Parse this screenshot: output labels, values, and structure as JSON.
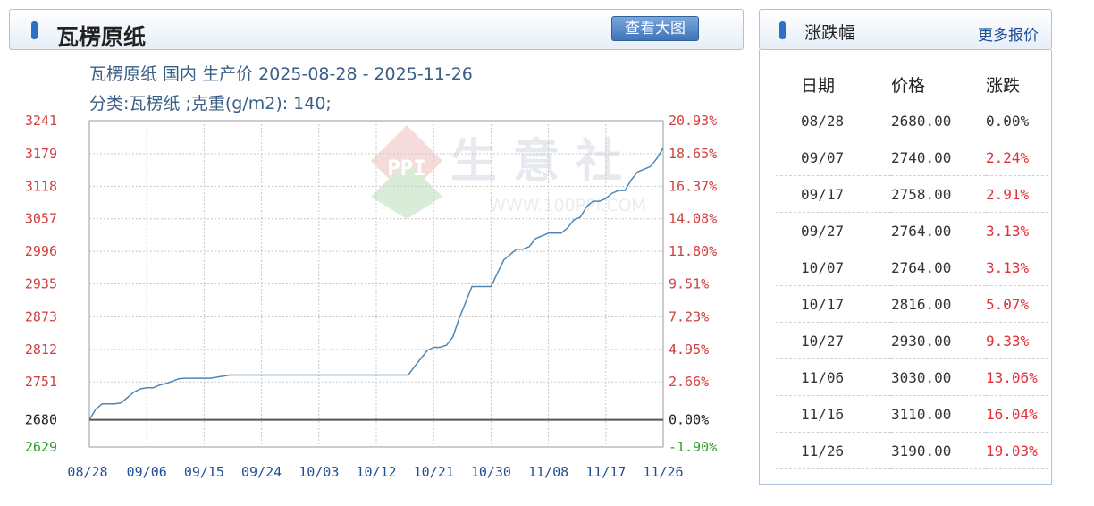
{
  "left_panel": {
    "title": "瓦楞原纸",
    "view_large_label": "查看大图"
  },
  "right_panel": {
    "title": "涨跌幅",
    "more_link": "更多报价"
  },
  "chart_data": {
    "type": "line",
    "title": "瓦楞原纸 国内 生产价 2025-08-28 - 2025-11-26",
    "subtitle": "分类:瓦楞纸 ;克重(g/m2): 140;",
    "x_tick_labels": [
      "08/28",
      "09/06",
      "09/15",
      "09/24",
      "10/03",
      "10/12",
      "10/21",
      "10/30",
      "11/08",
      "11/17",
      "11/26"
    ],
    "y_tick_labels": [
      "3241",
      "3179",
      "3118",
      "3057",
      "2996",
      "2935",
      "2873",
      "2812",
      "2751",
      "2680",
      "2629"
    ],
    "y2_tick_labels": [
      "20.93%",
      "18.65%",
      "16.37%",
      "14.08%",
      "11.80%",
      "9.51%",
      "7.23%",
      "4.95%",
      "2.66%",
      "0.00%",
      "-1.90%"
    ],
    "ylim": [
      2629,
      3241
    ],
    "x_range_days": 90,
    "series": [
      {
        "points": [
          [
            0,
            2680
          ],
          [
            1,
            2700
          ],
          [
            2,
            2710
          ],
          [
            3,
            2710
          ],
          [
            4,
            2710
          ],
          [
            5,
            2712
          ],
          [
            6,
            2722
          ],
          [
            7,
            2732
          ],
          [
            8,
            2738
          ],
          [
            9,
            2740
          ],
          [
            10,
            2740
          ],
          [
            11,
            2745
          ],
          [
            12,
            2748
          ],
          [
            13,
            2752
          ],
          [
            14,
            2757
          ],
          [
            15,
            2758
          ],
          [
            16,
            2758
          ],
          [
            17,
            2758
          ],
          [
            18,
            2758
          ],
          [
            19,
            2758
          ],
          [
            20,
            2760
          ],
          [
            21,
            2762
          ],
          [
            22,
            2764
          ],
          [
            23,
            2764
          ],
          [
            24,
            2764
          ],
          [
            25,
            2764
          ],
          [
            26,
            2764
          ],
          [
            27,
            2764
          ],
          [
            28,
            2764
          ],
          [
            29,
            2764
          ],
          [
            30,
            2764
          ],
          [
            31,
            2764
          ],
          [
            32,
            2764
          ],
          [
            33,
            2764
          ],
          [
            34,
            2764
          ],
          [
            35,
            2764
          ],
          [
            36,
            2764
          ],
          [
            37,
            2764
          ],
          [
            38,
            2764
          ],
          [
            39,
            2764
          ],
          [
            40,
            2764
          ],
          [
            41,
            2764
          ],
          [
            42,
            2764
          ],
          [
            43,
            2764
          ],
          [
            44,
            2764
          ],
          [
            45,
            2764
          ],
          [
            46,
            2764
          ],
          [
            47,
            2764
          ],
          [
            48,
            2764
          ],
          [
            49,
            2764
          ],
          [
            50,
            2764
          ],
          [
            51,
            2780
          ],
          [
            52,
            2795
          ],
          [
            53,
            2810
          ],
          [
            54,
            2816
          ],
          [
            55,
            2816
          ],
          [
            56,
            2820
          ],
          [
            57,
            2835
          ],
          [
            58,
            2870
          ],
          [
            59,
            2900
          ],
          [
            60,
            2930
          ],
          [
            61,
            2930
          ],
          [
            62,
            2930
          ],
          [
            63,
            2930
          ],
          [
            64,
            2955
          ],
          [
            65,
            2980
          ],
          [
            66,
            2990
          ],
          [
            67,
            3000
          ],
          [
            68,
            3000
          ],
          [
            69,
            3005
          ],
          [
            70,
            3020
          ],
          [
            71,
            3025
          ],
          [
            72,
            3030
          ],
          [
            73,
            3030
          ],
          [
            74,
            3030
          ],
          [
            75,
            3040
          ],
          [
            76,
            3055
          ],
          [
            77,
            3060
          ],
          [
            78,
            3080
          ],
          [
            79,
            3090
          ],
          [
            80,
            3090
          ],
          [
            81,
            3095
          ],
          [
            82,
            3105
          ],
          [
            83,
            3110
          ],
          [
            84,
            3110
          ],
          [
            85,
            3130
          ],
          [
            86,
            3145
          ],
          [
            87,
            3150
          ],
          [
            88,
            3155
          ],
          [
            89,
            3170
          ],
          [
            90,
            3190
          ]
        ]
      }
    ],
    "colors": {
      "line": "#4f86b6",
      "left_axis": "#d04040",
      "right_axis": "#d04040",
      "neg_axis": "#2f9a2f",
      "x_axis": "#1f4f98"
    },
    "watermark": {
      "logo_text": "PPI",
      "brand": "生 意 社",
      "url": "WWW.100PPI.COM"
    }
  },
  "price_table": {
    "headers": [
      "日期",
      "价格",
      "涨跌"
    ],
    "rows": [
      {
        "date": "08/28",
        "price": "2680.00",
        "change": "0.00%"
      },
      {
        "date": "09/07",
        "price": "2740.00",
        "change": "2.24%"
      },
      {
        "date": "09/17",
        "price": "2758.00",
        "change": "2.91%"
      },
      {
        "date": "09/27",
        "price": "2764.00",
        "change": "3.13%"
      },
      {
        "date": "10/07",
        "price": "2764.00",
        "change": "3.13%"
      },
      {
        "date": "10/17",
        "price": "2816.00",
        "change": "5.07%"
      },
      {
        "date": "10/27",
        "price": "2930.00",
        "change": "9.33%"
      },
      {
        "date": "11/06",
        "price": "3030.00",
        "change": "13.06%"
      },
      {
        "date": "11/16",
        "price": "3110.00",
        "change": "16.04%"
      },
      {
        "date": "11/26",
        "price": "3190.00",
        "change": "19.03%"
      }
    ]
  }
}
